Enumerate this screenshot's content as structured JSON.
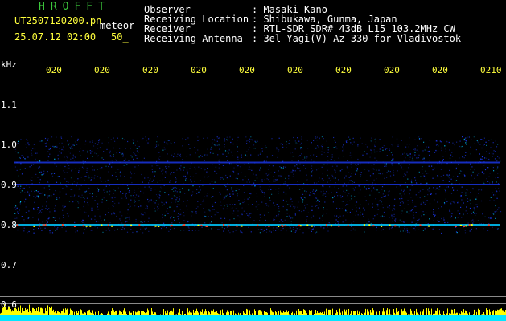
{
  "header": {
    "app_title": "HROFFT",
    "file_name": "UT2507120200.pn",
    "meteor_label": "meteor",
    "timestamp": "25.07.12 02:00",
    "count": "50_"
  },
  "info": {
    "observer_label": "Observer",
    "location_label": "Receiving Location",
    "receiver_label": "Receiver",
    "antenna_label": "Receiving Antenna",
    "observer_value": ": Masaki Kano",
    "location_value": ": Shibukawa, Gunma, Japan",
    "receiver_value": ": RTL-SDR SDR# 43dB L15 103.2MHz CW",
    "antenna_value": ": 3el Yagi(V) Az 330 for Vladivostok"
  },
  "colors": {
    "background": "#000000",
    "tick_text": "#ffff3c",
    "title": "#3cc83c",
    "signal_low": "#1e3cff",
    "signal_mid": "#00c8ff",
    "signal_high": "#ff3c1e",
    "level_bar": "#ffff00",
    "baseline": "#00e6ff"
  },
  "chart_data": {
    "type": "heatmap",
    "ylabel": "kHz",
    "time_ticks": [
      "020",
      "020",
      "020",
      "020",
      "020",
      "020",
      "020",
      "020",
      "020",
      "0210"
    ],
    "freq_ticks": [
      "1.1",
      "1.0",
      "0.9",
      "0.8",
      "0.7",
      "0.6"
    ],
    "ylim": [
      0.6,
      1.1
    ],
    "band_range_khz": [
      0.78,
      1.02
    ],
    "bands": [
      {
        "freq_khz": 0.8,
        "strength": "strong"
      },
      {
        "freq_khz": 0.9,
        "strength": "medium"
      },
      {
        "freq_khz": 0.955,
        "strength": "medium"
      }
    ]
  }
}
